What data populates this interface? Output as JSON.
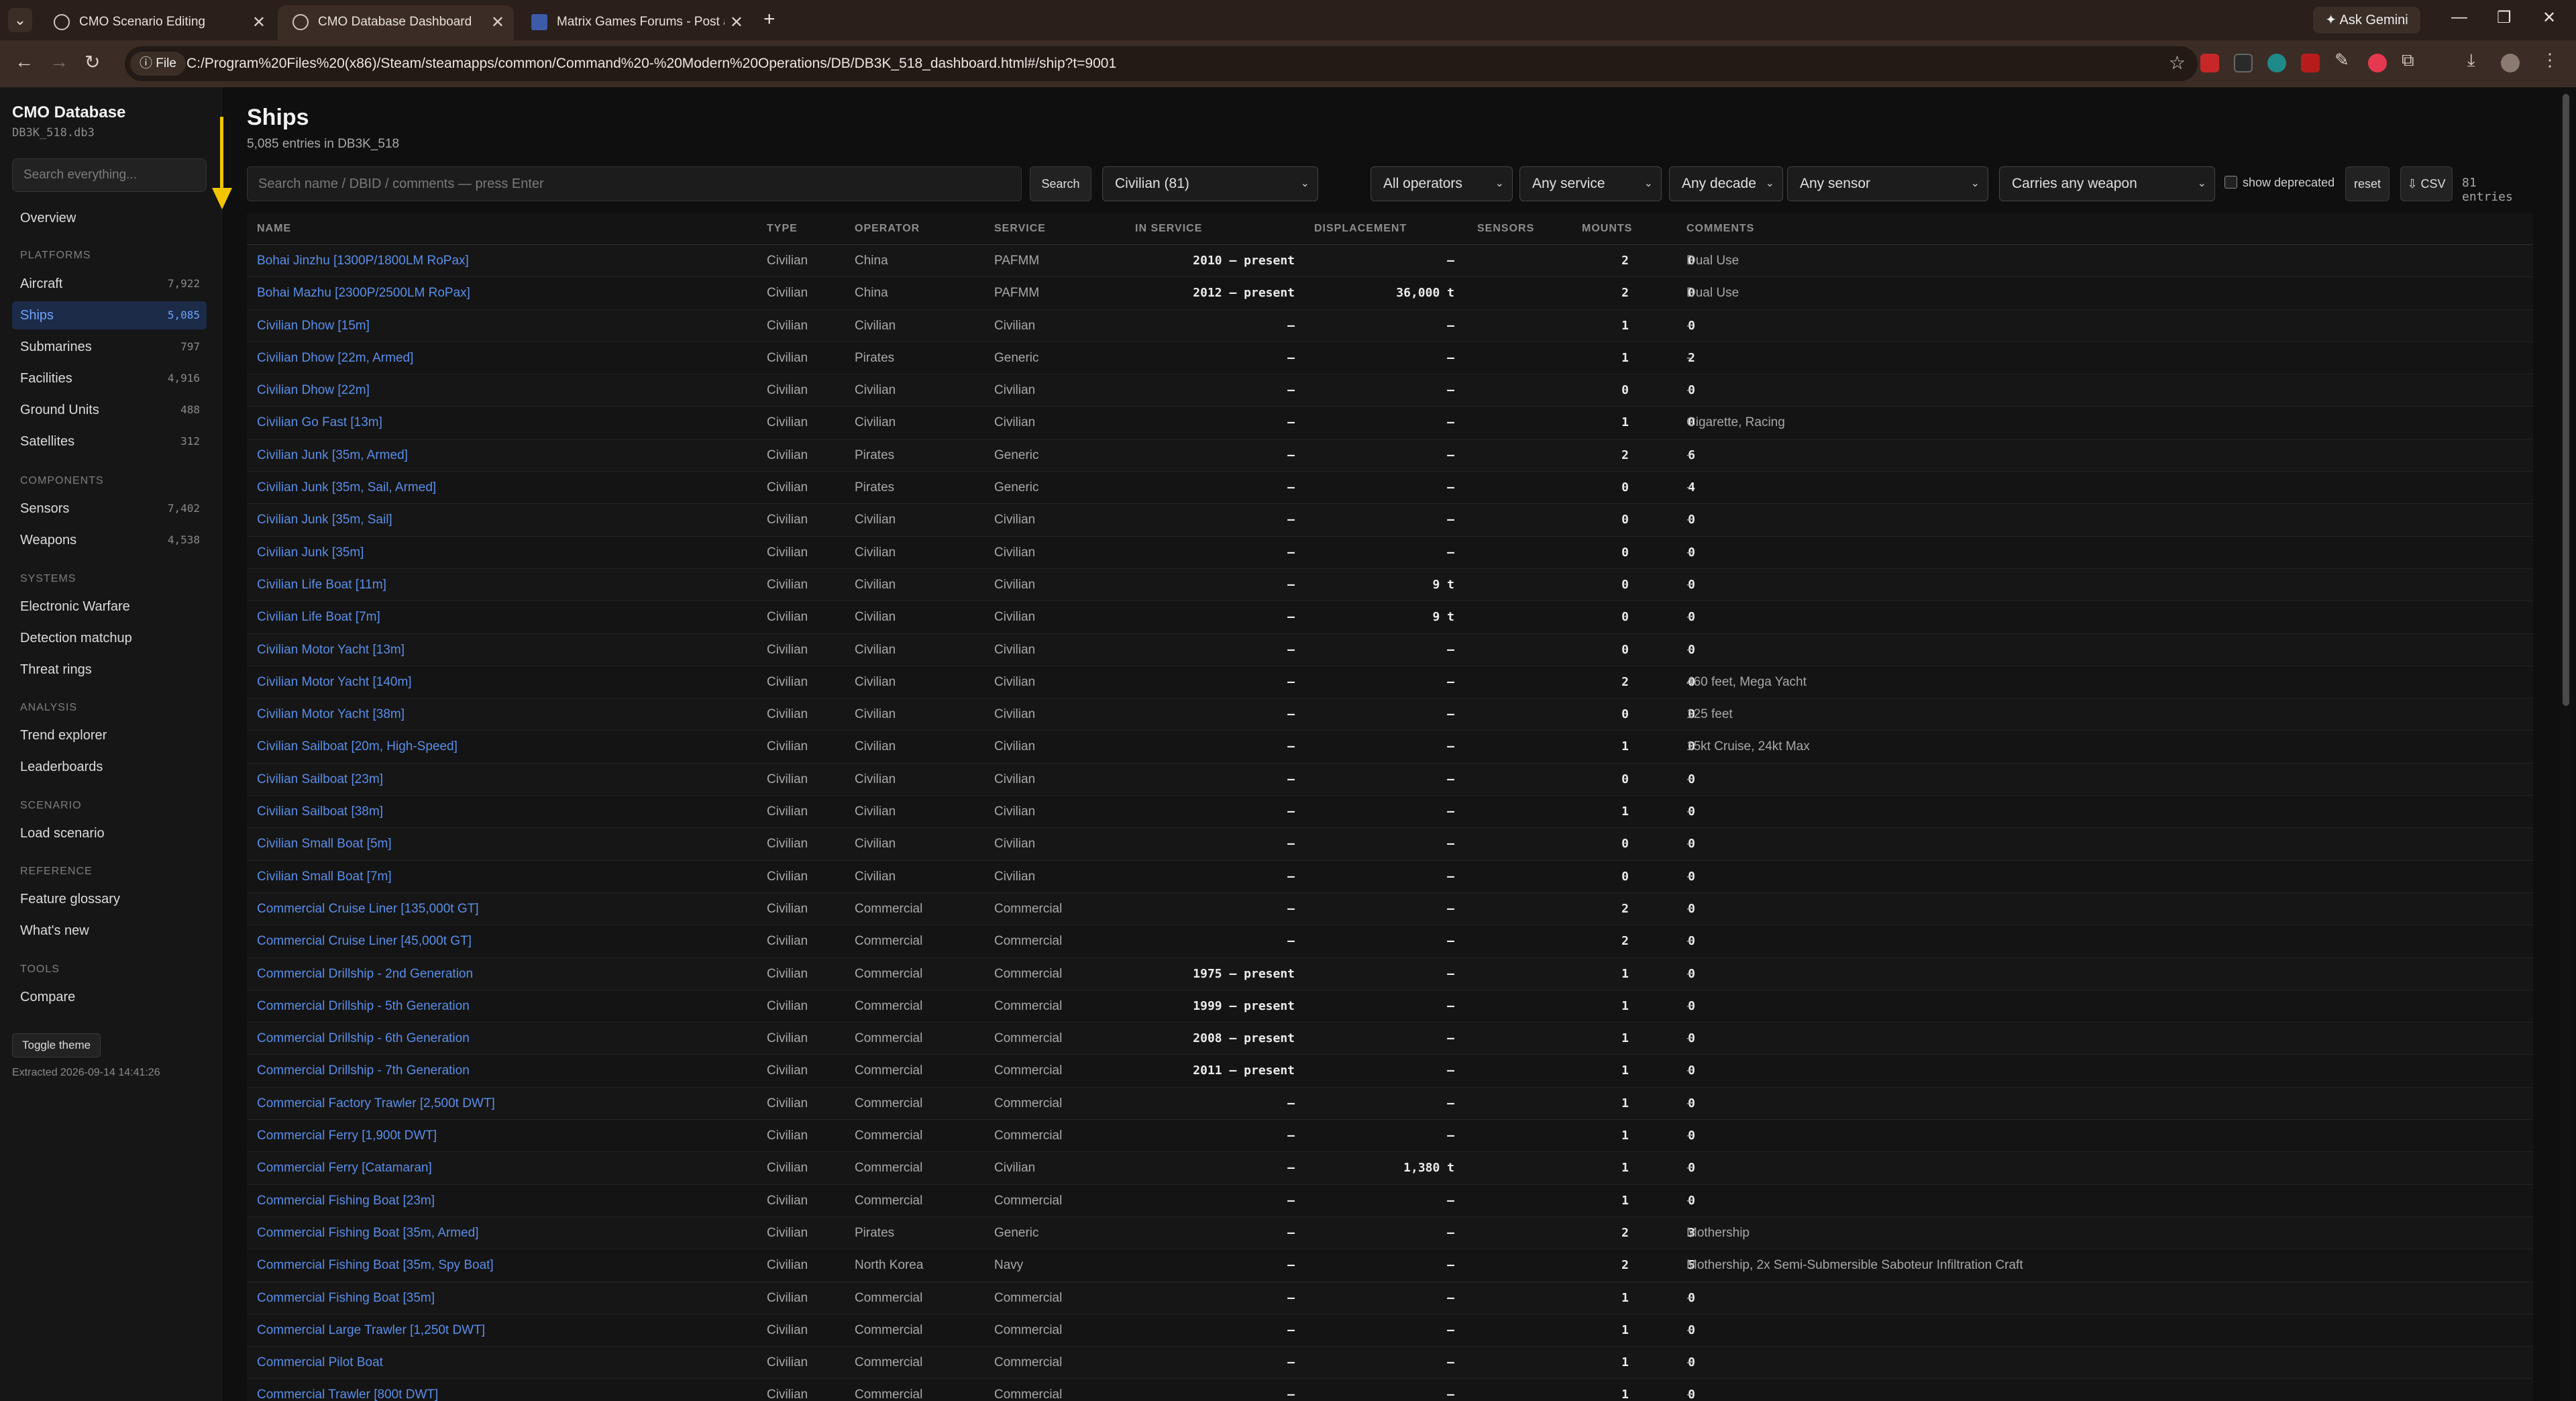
{
  "browser": {
    "tabs": [
      {
        "title": "CMO Scenario Editing",
        "close": "✕"
      },
      {
        "title": "CMO Database Dashboard",
        "close": "✕"
      },
      {
        "title": "Matrix Games Forums - Post a r",
        "close": "✕"
      }
    ],
    "new_tab": "+",
    "gemini_label": "✦ Ask Gemini",
    "url_chip": "ⓘ File",
    "url": "C:/Program%20Files%20(x86)/Steam/steamapps/common/Command%20-%20Modern%20Operations/DB/DB3K_518_dashboard.html#/ship?t=9001",
    "extensions": [
      {
        "name": "abp-icon",
        "color": "#c62828"
      },
      {
        "name": "extension-dark-icon",
        "color": "#2a2a2a"
      },
      {
        "name": "extension-teal-icon",
        "color": "#1f8a8a"
      },
      {
        "name": "extension-red-icon",
        "color": "#b71c1c"
      },
      {
        "name": "extension-pen-icon",
        "color": "#3b2d25"
      },
      {
        "name": "extension-pink-icon",
        "color": "#e53950"
      },
      {
        "name": "puzzle-icon",
        "color": "#3b2d25"
      }
    ]
  },
  "sidebar": {
    "brand": "CMO Database",
    "db_file": "DB3K_518.db3",
    "search_placeholder": "Search everything...",
    "overview": "Overview",
    "sections": {
      "platforms": "PLATFORMS",
      "components": "COMPONENTS",
      "systems": "SYSTEMS",
      "analysis": "ANALYSIS",
      "scenario": "SCENARIO",
      "reference": "REFERENCE",
      "tools": "TOOLS"
    },
    "platforms": [
      {
        "label": "Aircraft",
        "count": "7,922"
      },
      {
        "label": "Ships",
        "count": "5,085"
      },
      {
        "label": "Submarines",
        "count": "797"
      },
      {
        "label": "Facilities",
        "count": "4,916"
      },
      {
        "label": "Ground Units",
        "count": "488"
      },
      {
        "label": "Satellites",
        "count": "312"
      }
    ],
    "components": [
      {
        "label": "Sensors",
        "count": "7,402"
      },
      {
        "label": "Weapons",
        "count": "4,538"
      }
    ],
    "systems": [
      "Electronic Warfare",
      "Detection matchup",
      "Threat rings"
    ],
    "analysis": [
      "Trend explorer",
      "Leaderboards"
    ],
    "scenario": [
      "Load scenario"
    ],
    "reference": [
      "Feature glossary",
      "What's new"
    ],
    "tools": [
      "Compare"
    ],
    "toggle_theme": "Toggle theme",
    "extracted": "Extracted 2026-09-14 14:41:26"
  },
  "main": {
    "title": "Ships",
    "subtitle": "5,085 entries in DB3K_518",
    "search_placeholder": "Search name / DBID / comments — press Enter",
    "search_btn": "Search",
    "filter_type": "Civilian (81)",
    "filter_operator": "All operators",
    "filter_service": "Any service",
    "filter_decade": "Any decade",
    "filter_sensor": "Any sensor",
    "filter_weapon": "Carries any weapon",
    "show_deprecated": "show deprecated",
    "reset": "reset",
    "csv": "⇩ CSV",
    "entries": "81 entries",
    "columns": [
      "NAME",
      "TYPE",
      "OPERATOR",
      "SERVICE",
      "IN SERVICE",
      "DISPLACEMENT",
      "SENSORS",
      "MOUNTS",
      "COMMENTS"
    ],
    "rows": [
      {
        "name": "Bohai Jinzhu [1300P/1800LM RoPax]",
        "type": "Civilian",
        "operator": "China",
        "service": "PAFMM",
        "in_service": "2010 – present",
        "displacement": "–",
        "sensors": "2",
        "mounts": "0",
        "comments": "Dual Use"
      },
      {
        "name": "Bohai Mazhu [2300P/2500LM RoPax]",
        "type": "Civilian",
        "operator": "China",
        "service": "PAFMM",
        "in_service": "2012 – present",
        "displacement": "36,000 t",
        "sensors": "2",
        "mounts": "0",
        "comments": "Dual Use"
      },
      {
        "name": "Civilian Dhow [15m]",
        "type": "Civilian",
        "operator": "Civilian",
        "service": "Civilian",
        "in_service": "–",
        "displacement": "–",
        "sensors": "1",
        "mounts": "0",
        "comments": "-"
      },
      {
        "name": "Civilian Dhow [22m, Armed]",
        "type": "Civilian",
        "operator": "Pirates",
        "service": "Generic",
        "in_service": "–",
        "displacement": "–",
        "sensors": "1",
        "mounts": "2",
        "comments": "-"
      },
      {
        "name": "Civilian Dhow [22m]",
        "type": "Civilian",
        "operator": "Civilian",
        "service": "Civilian",
        "in_service": "–",
        "displacement": "–",
        "sensors": "0",
        "mounts": "0",
        "comments": "-"
      },
      {
        "name": "Civilian Go Fast [13m]",
        "type": "Civilian",
        "operator": "Civilian",
        "service": "Civilian",
        "in_service": "–",
        "displacement": "–",
        "sensors": "1",
        "mounts": "0",
        "comments": "Cigarette, Racing"
      },
      {
        "name": "Civilian Junk [35m, Armed]",
        "type": "Civilian",
        "operator": "Pirates",
        "service": "Generic",
        "in_service": "–",
        "displacement": "–",
        "sensors": "2",
        "mounts": "6",
        "comments": "-"
      },
      {
        "name": "Civilian Junk [35m, Sail, Armed]",
        "type": "Civilian",
        "operator": "Pirates",
        "service": "Generic",
        "in_service": "–",
        "displacement": "–",
        "sensors": "0",
        "mounts": "4",
        "comments": "-"
      },
      {
        "name": "Civilian Junk [35m, Sail]",
        "type": "Civilian",
        "operator": "Civilian",
        "service": "Civilian",
        "in_service": "–",
        "displacement": "–",
        "sensors": "0",
        "mounts": "0",
        "comments": "-"
      },
      {
        "name": "Civilian Junk [35m]",
        "type": "Civilian",
        "operator": "Civilian",
        "service": "Civilian",
        "in_service": "–",
        "displacement": "–",
        "sensors": "0",
        "mounts": "0",
        "comments": "-"
      },
      {
        "name": "Civilian Life Boat [11m]",
        "type": "Civilian",
        "operator": "Civilian",
        "service": "Civilian",
        "in_service": "–",
        "displacement": "9 t",
        "sensors": "0",
        "mounts": "0",
        "comments": "-"
      },
      {
        "name": "Civilian Life Boat [7m]",
        "type": "Civilian",
        "operator": "Civilian",
        "service": "Civilian",
        "in_service": "–",
        "displacement": "9 t",
        "sensors": "0",
        "mounts": "0",
        "comments": "-"
      },
      {
        "name": "Civilian Motor Yacht [13m]",
        "type": "Civilian",
        "operator": "Civilian",
        "service": "Civilian",
        "in_service": "–",
        "displacement": "–",
        "sensors": "0",
        "mounts": "0",
        "comments": "-"
      },
      {
        "name": "Civilian Motor Yacht [140m]",
        "type": "Civilian",
        "operator": "Civilian",
        "service": "Civilian",
        "in_service": "–",
        "displacement": "–",
        "sensors": "2",
        "mounts": "0",
        "comments": "460 feet, Mega Yacht"
      },
      {
        "name": "Civilian Motor Yacht [38m]",
        "type": "Civilian",
        "operator": "Civilian",
        "service": "Civilian",
        "in_service": "–",
        "displacement": "–",
        "sensors": "0",
        "mounts": "0",
        "comments": "125 feet"
      },
      {
        "name": "Civilian Sailboat [20m, High-Speed]",
        "type": "Civilian",
        "operator": "Civilian",
        "service": "Civilian",
        "in_service": "–",
        "displacement": "–",
        "sensors": "1",
        "mounts": "0",
        "comments": "15kt Cruise, 24kt Max"
      },
      {
        "name": "Civilian Sailboat [23m]",
        "type": "Civilian",
        "operator": "Civilian",
        "service": "Civilian",
        "in_service": "–",
        "displacement": "–",
        "sensors": "0",
        "mounts": "0",
        "comments": "-"
      },
      {
        "name": "Civilian Sailboat [38m]",
        "type": "Civilian",
        "operator": "Civilian",
        "service": "Civilian",
        "in_service": "–",
        "displacement": "–",
        "sensors": "1",
        "mounts": "0",
        "comments": "-"
      },
      {
        "name": "Civilian Small Boat [5m]",
        "type": "Civilian",
        "operator": "Civilian",
        "service": "Civilian",
        "in_service": "–",
        "displacement": "–",
        "sensors": "0",
        "mounts": "0",
        "comments": "-"
      },
      {
        "name": "Civilian Small Boat [7m]",
        "type": "Civilian",
        "operator": "Civilian",
        "service": "Civilian",
        "in_service": "–",
        "displacement": "–",
        "sensors": "0",
        "mounts": "0",
        "comments": "-"
      },
      {
        "name": "Commercial Cruise Liner [135,000t GT]",
        "type": "Civilian",
        "operator": "Commercial",
        "service": "Commercial",
        "in_service": "–",
        "displacement": "–",
        "sensors": "2",
        "mounts": "0",
        "comments": "-"
      },
      {
        "name": "Commercial Cruise Liner [45,000t GT]",
        "type": "Civilian",
        "operator": "Commercial",
        "service": "Commercial",
        "in_service": "–",
        "displacement": "–",
        "sensors": "2",
        "mounts": "0",
        "comments": "-"
      },
      {
        "name": "Commercial Drillship - 2nd Generation",
        "type": "Civilian",
        "operator": "Commercial",
        "service": "Commercial",
        "in_service": "1975 – present",
        "displacement": "–",
        "sensors": "1",
        "mounts": "0",
        "comments": "-"
      },
      {
        "name": "Commercial Drillship - 5th Generation",
        "type": "Civilian",
        "operator": "Commercial",
        "service": "Commercial",
        "in_service": "1999 – present",
        "displacement": "–",
        "sensors": "1",
        "mounts": "0",
        "comments": "-"
      },
      {
        "name": "Commercial Drillship - 6th Generation",
        "type": "Civilian",
        "operator": "Commercial",
        "service": "Commercial",
        "in_service": "2008 – present",
        "displacement": "–",
        "sensors": "1",
        "mounts": "0",
        "comments": "-"
      },
      {
        "name": "Commercial Drillship - 7th Generation",
        "type": "Civilian",
        "operator": "Commercial",
        "service": "Commercial",
        "in_service": "2011 – present",
        "displacement": "–",
        "sensors": "1",
        "mounts": "0",
        "comments": "-"
      },
      {
        "name": "Commercial Factory Trawler [2,500t DWT]",
        "type": "Civilian",
        "operator": "Commercial",
        "service": "Commercial",
        "in_service": "–",
        "displacement": "–",
        "sensors": "1",
        "mounts": "0",
        "comments": "-"
      },
      {
        "name": "Commercial Ferry [1,900t DWT]",
        "type": "Civilian",
        "operator": "Commercial",
        "service": "Commercial",
        "in_service": "–",
        "displacement": "–",
        "sensors": "1",
        "mounts": "0",
        "comments": "-"
      },
      {
        "name": "Commercial Ferry [Catamaran]",
        "type": "Civilian",
        "operator": "Commercial",
        "service": "Civilian",
        "in_service": "–",
        "displacement": "1,380 t",
        "sensors": "1",
        "mounts": "0",
        "comments": "-"
      },
      {
        "name": "Commercial Fishing Boat [23m]",
        "type": "Civilian",
        "operator": "Commercial",
        "service": "Commercial",
        "in_service": "–",
        "displacement": "–",
        "sensors": "1",
        "mounts": "0",
        "comments": "-"
      },
      {
        "name": "Commercial Fishing Boat [35m, Armed]",
        "type": "Civilian",
        "operator": "Pirates",
        "service": "Generic",
        "in_service": "–",
        "displacement": "–",
        "sensors": "2",
        "mounts": "3",
        "comments": "Mothership"
      },
      {
        "name": "Commercial Fishing Boat [35m, Spy Boat]",
        "type": "Civilian",
        "operator": "North Korea",
        "service": "Navy",
        "in_service": "–",
        "displacement": "–",
        "sensors": "2",
        "mounts": "5",
        "comments": "Mothership, 2x Semi-Submersible Saboteur Infiltration Craft"
      },
      {
        "name": "Commercial Fishing Boat [35m]",
        "type": "Civilian",
        "operator": "Commercial",
        "service": "Commercial",
        "in_service": "–",
        "displacement": "–",
        "sensors": "1",
        "mounts": "0",
        "comments": "-"
      },
      {
        "name": "Commercial Large Trawler [1,250t DWT]",
        "type": "Civilian",
        "operator": "Commercial",
        "service": "Commercial",
        "in_service": "–",
        "displacement": "–",
        "sensors": "1",
        "mounts": "0",
        "comments": "-"
      },
      {
        "name": "Commercial Pilot Boat",
        "type": "Civilian",
        "operator": "Commercial",
        "service": "Commercial",
        "in_service": "–",
        "displacement": "–",
        "sensors": "1",
        "mounts": "0",
        "comments": "-"
      },
      {
        "name": "Commercial Trawler [800t DWT]",
        "type": "Civilian",
        "operator": "Commercial",
        "service": "Commercial",
        "in_service": "–",
        "displacement": "–",
        "sensors": "1",
        "mounts": "0",
        "comments": "-"
      }
    ]
  }
}
